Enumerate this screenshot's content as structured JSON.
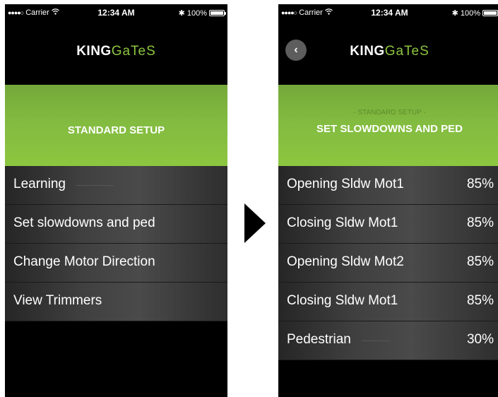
{
  "status": {
    "carrier": "Carrier",
    "time": "12:34 AM",
    "battery": "100%"
  },
  "logo": {
    "king": "KING",
    "gates": "GaTeS"
  },
  "left_screen": {
    "banner_title": "STANDARD SETUP",
    "menu": [
      {
        "label": "Learning"
      },
      {
        "label": "Set slowdowns and ped"
      },
      {
        "label": "Change Motor Direction"
      },
      {
        "label": "View Trimmers"
      }
    ]
  },
  "right_screen": {
    "banner_subtitle": "- STANDARD SETUP -",
    "banner_title": "SET SLOWDOWNS AND PED",
    "rows": [
      {
        "label": "Opening Sldw Mot1",
        "value": "85%"
      },
      {
        "label": "Closing Sldw Mot1",
        "value": "85%"
      },
      {
        "label": "Opening Sldw Mot2",
        "value": "85%"
      },
      {
        "label": "Closing Sldw Mot1",
        "value": "85%"
      },
      {
        "label": "Pedestrian",
        "value": "30%"
      }
    ]
  },
  "colors": {
    "accent": "#8cc63f"
  }
}
